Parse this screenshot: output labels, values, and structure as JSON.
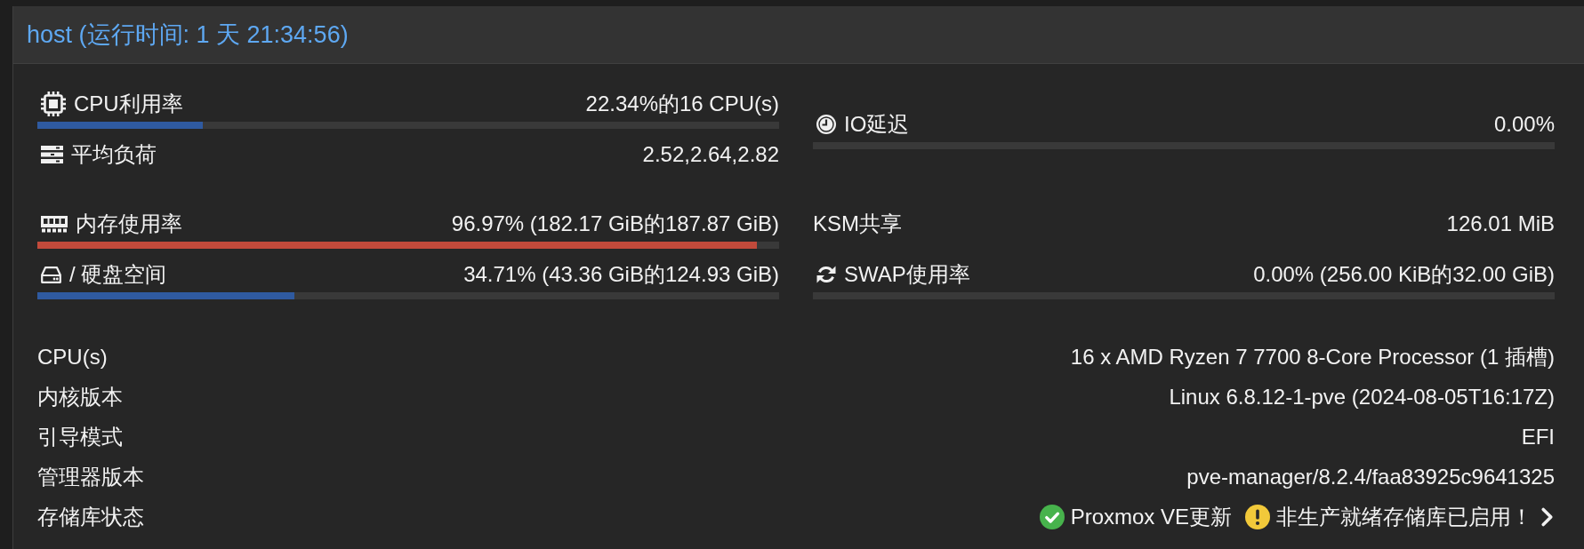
{
  "panel": {
    "title": "host (运行时间: 1 天 21:34:56)"
  },
  "cpu_usage": {
    "label": "CPU利用率",
    "reading": "22.34%的16 CPU(s)",
    "level": 0.2234
  },
  "load_average": {
    "label": "平均负荷",
    "reading": "2.52,2.64,2.82"
  },
  "io_delay": {
    "label": "IO延迟",
    "reading": "0.00%",
    "level": 0
  },
  "memory_usage": {
    "label": "内存使用率",
    "reading": "96.97% (182.17 GiB的187.87 GiB)",
    "level": 0.9697
  },
  "ksm_sharing": {
    "label": "KSM共享",
    "reading": "126.01 MiB"
  },
  "disk_space": {
    "label": "/ 硬盘空间",
    "reading": "34.71% (43.36 GiB的124.93 GiB)",
    "level": 0.3471
  },
  "swap_usage": {
    "label": "SWAP使用率",
    "reading": "0.00% (256.00 KiB的32.00 GiB)",
    "level": 0
  },
  "details": [
    {
      "label": "CPU(s)",
      "value": "16 x AMD Ryzen 7 7700 8-Core Processor (1 插槽)"
    },
    {
      "label": "内核版本",
      "value": "Linux 6.8.12-1-pve (2024-08-05T16:17Z)"
    },
    {
      "label": "引导模式",
      "value": "EFI"
    },
    {
      "label": "管理器版本",
      "value": "pve-manager/8.2.4/faa83925c9641325"
    }
  ],
  "repository_status": {
    "label": "存储库状态",
    "items": [
      {
        "kind": "ok",
        "text": "Proxmox VE更新"
      },
      {
        "kind": "warning",
        "text": "非生产就绪存储库已启用！"
      }
    ]
  }
}
